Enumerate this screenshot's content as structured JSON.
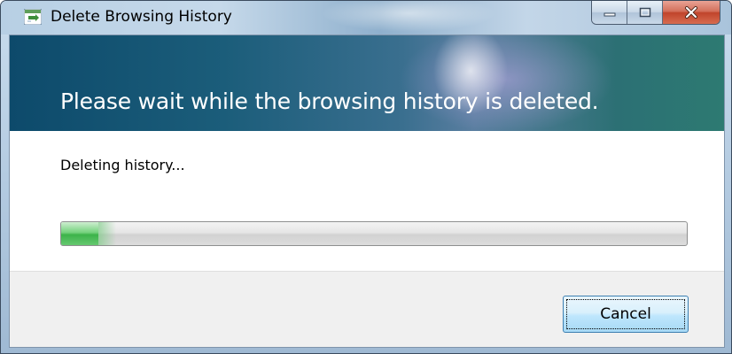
{
  "window": {
    "title": "Delete Browsing History",
    "icon": "delete-history-icon"
  },
  "caption_buttons": {
    "minimize_icon": "minimize-icon",
    "maximize_icon": "maximize-icon",
    "close_icon": "close-icon"
  },
  "banner": {
    "message": "Please wait while the browsing history is deleted."
  },
  "status": {
    "text": "Deleting history..."
  },
  "progress": {
    "fraction": 0.06
  },
  "footer": {
    "cancel_label": "Cancel"
  },
  "colors": {
    "banner": "#1b5d7a",
    "progress_fill": "#3cb34a",
    "close_button": "#c0442b"
  }
}
